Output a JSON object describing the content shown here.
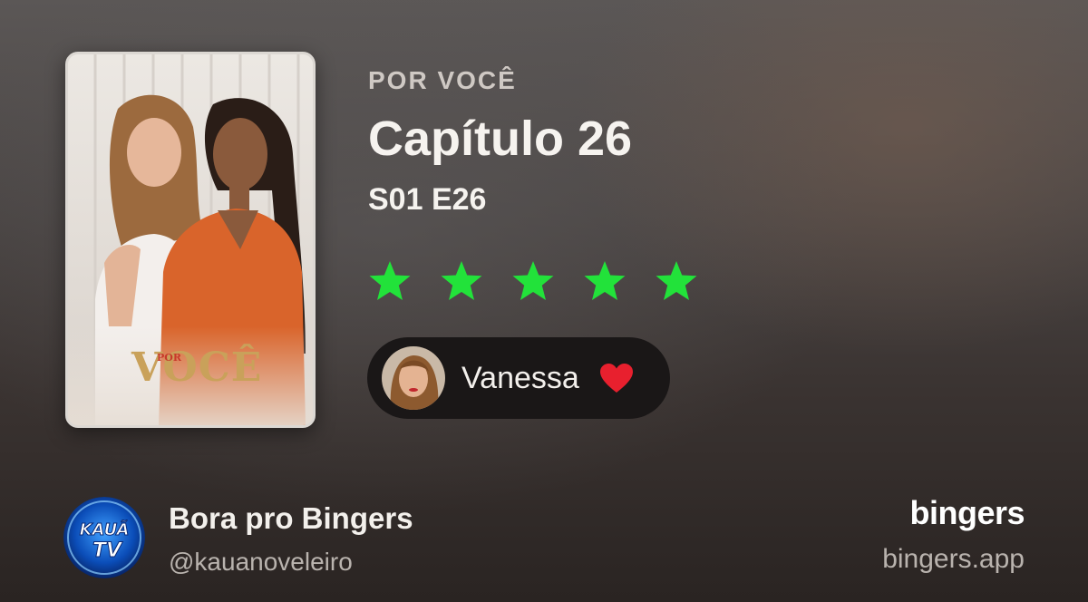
{
  "show": {
    "name": "POR VOCÊ"
  },
  "episode": {
    "title": "Capítulo 26",
    "code": "S01 E26"
  },
  "rating": {
    "stars": 5,
    "max": 5,
    "color": "#22e23a"
  },
  "poster": {
    "logo_small": "POR",
    "logo_large": "VOCÊ"
  },
  "reviewer": {
    "name": "Vanessa",
    "reaction_icon": "heart-icon",
    "heart_color": "#e8202e"
  },
  "profile": {
    "name": "Bora pro Bingers",
    "handle": "@kauanoveleiro",
    "avatar_text_top": "KAUÃ",
    "avatar_text_bottom": "TV"
  },
  "brand": {
    "logo": "bingers",
    "url": "bingers.app"
  }
}
